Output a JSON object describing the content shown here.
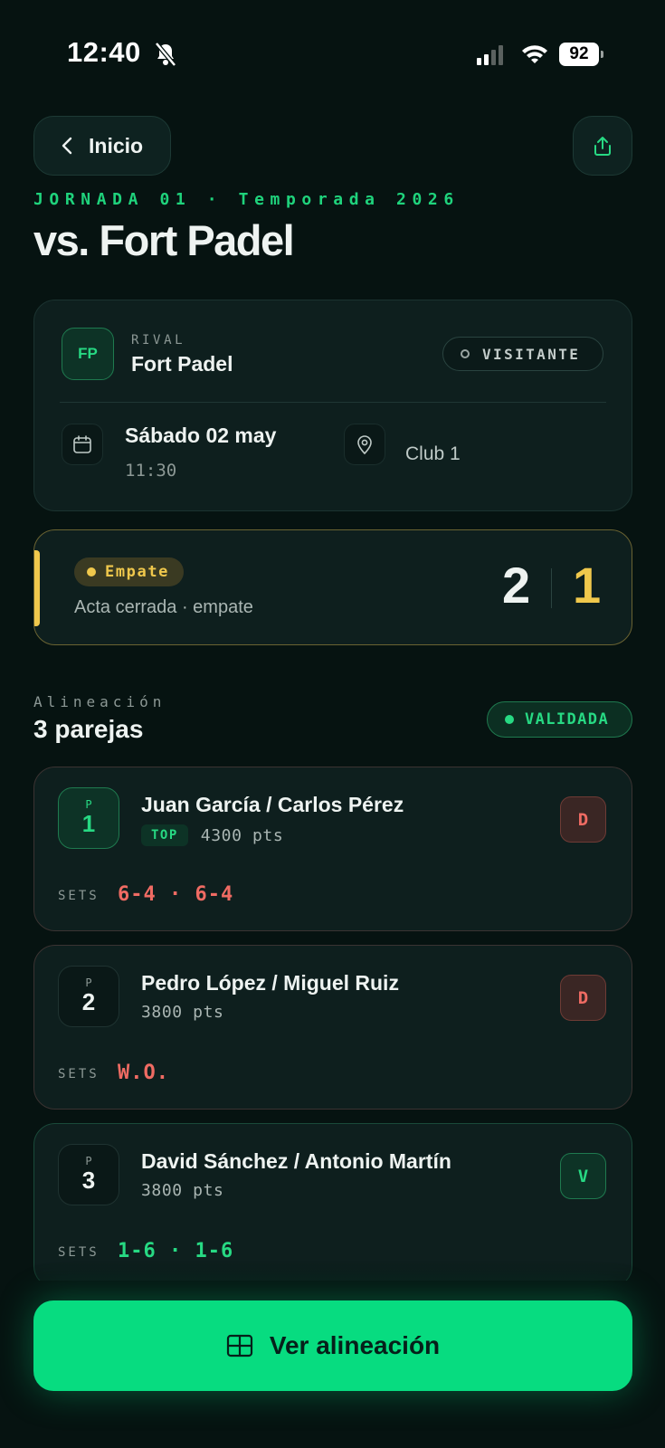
{
  "status_bar": {
    "time": "12:40",
    "battery": "92"
  },
  "header": {
    "back_label": "Inicio"
  },
  "eyebrow": "JORNADA 01 · Temporada 2026",
  "title": "vs. Fort Padel",
  "match": {
    "rival_initials": "FP",
    "rival_label": "RIVAL",
    "rival_name": "Fort Padel",
    "location_type": "VISITANTE",
    "date": "Sábado 02 may",
    "time": "11:30",
    "venue": "Club 1"
  },
  "result": {
    "status": "Empate",
    "subtitle": "Acta cerrada · empate",
    "home_score": "2",
    "away_score": "1"
  },
  "lineup": {
    "eyebrow": "Alineación",
    "title": "3 parejas",
    "status": "VALIDADA",
    "pairs": [
      {
        "pos_label": "P",
        "pos": "1",
        "names": "Juan García / Carlos Pérez",
        "tag": "TOP",
        "points": "4300 pts",
        "result": "D",
        "sets_label": "SETS",
        "sets": "6-4 · 6-4"
      },
      {
        "pos_label": "P",
        "pos": "2",
        "names": "Pedro López / Miguel Ruiz",
        "points": "3800 pts",
        "result": "D",
        "sets_label": "SETS",
        "sets": "W.O."
      },
      {
        "pos_label": "P",
        "pos": "3",
        "names": "David Sánchez / Antonio Martín",
        "points": "3800 pts",
        "result": "V",
        "sets_label": "SETS",
        "sets": "1-6 · 1-6"
      }
    ]
  },
  "cta": {
    "label": "Ver alineación"
  },
  "colors": {
    "accent_green": "#07dc80",
    "draw_yellow": "#f0c84c",
    "loss_red": "#ef6b63",
    "background": "#061311"
  },
  "icons": [
    "bell-slash-icon",
    "signal-icon",
    "wifi-icon",
    "battery-icon",
    "chevron-left-icon",
    "share-icon",
    "calendar-icon",
    "map-pin-icon",
    "grid-icon"
  ]
}
